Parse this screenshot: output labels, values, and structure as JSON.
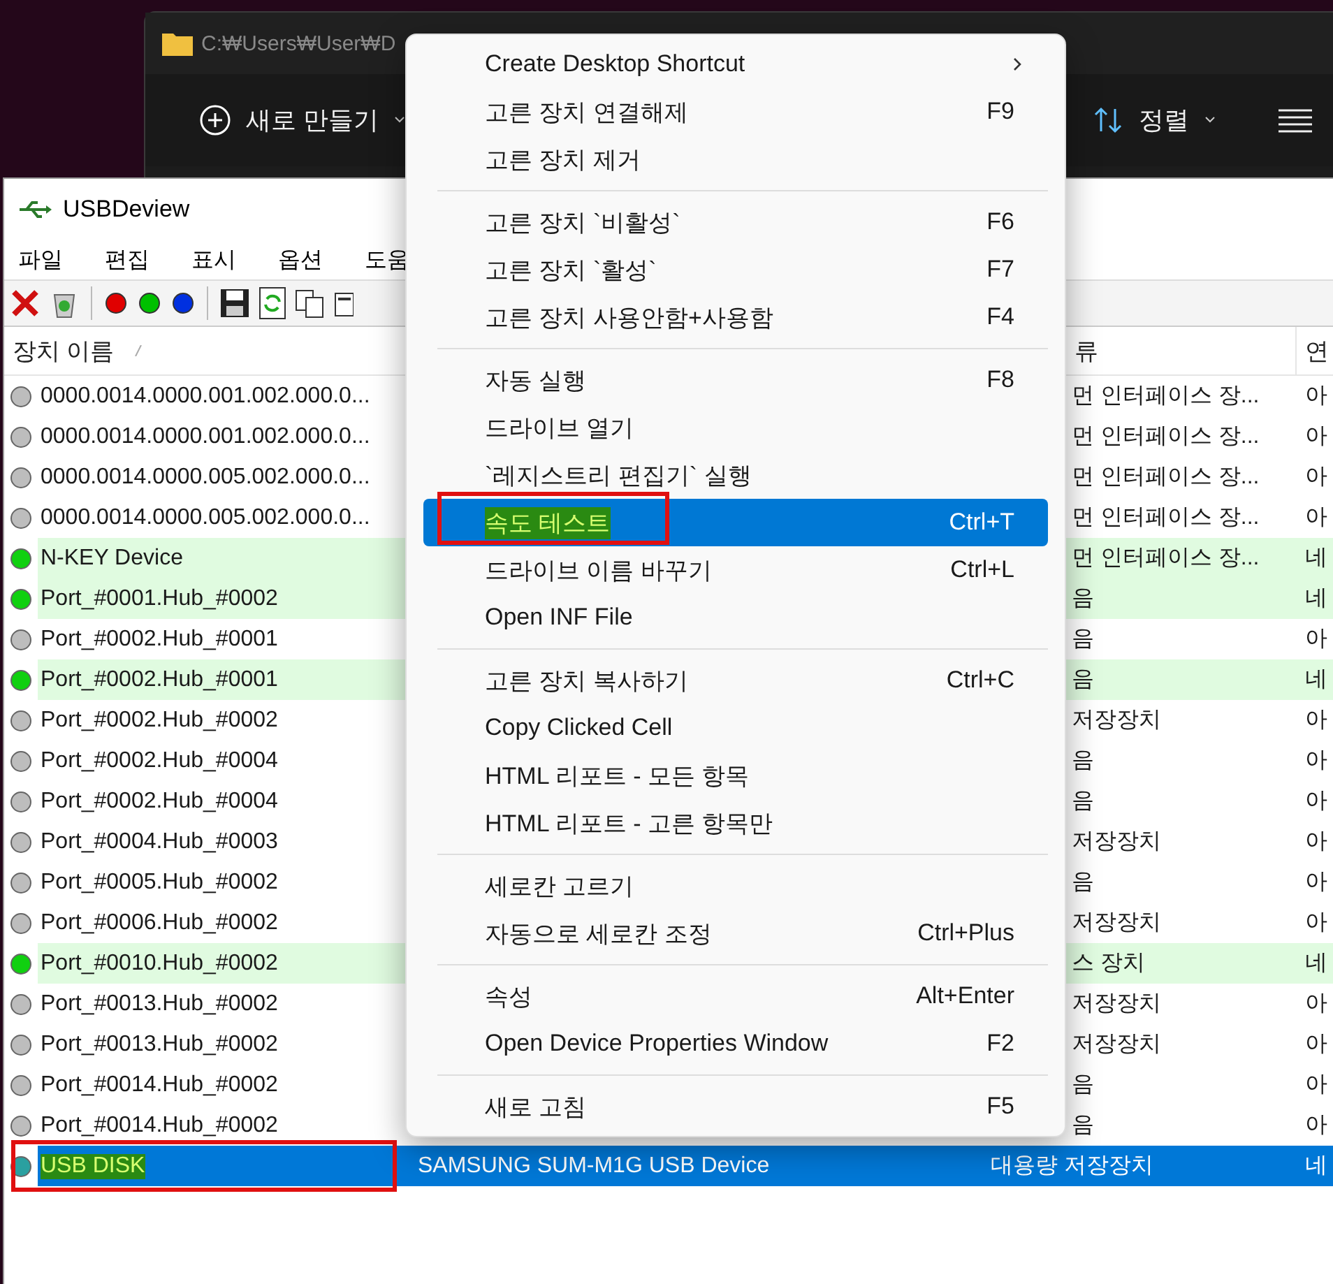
{
  "explorer": {
    "path": "C:₩Users₩User₩D",
    "toolbar": [
      {
        "kind": "new",
        "label": "새로 만들기"
      },
      {
        "kind": "sort",
        "label": "정렬"
      },
      {
        "kind": "view"
      }
    ]
  },
  "app": {
    "title": "USBDeview",
    "menu": [
      "파일",
      "편집",
      "표시",
      "옵션",
      "도움"
    ],
    "toolbar": [
      {
        "kind": "delete"
      },
      {
        "kind": "recycle"
      },
      {
        "kind": "dot",
        "color": "#e00000"
      },
      {
        "kind": "dot",
        "color": "#00c000"
      },
      {
        "kind": "dot",
        "color": "#0030e0"
      },
      {
        "kind": "save"
      },
      {
        "kind": "refresh"
      },
      {
        "kind": "copy"
      },
      {
        "kind": "properties"
      }
    ],
    "columns": [
      {
        "label": "장치 이름",
        "sorted": true
      },
      {
        "label": "류"
      },
      {
        "label": "연"
      }
    ],
    "rows": [
      {
        "name": "0000.0014.0000.001.002.000.0...",
        "connected": false,
        "selected": false,
        "type": "먼 인터페이스 장...",
        "column_4": "아"
      },
      {
        "name": "0000.0014.0000.001.002.000.0...",
        "connected": false,
        "selected": false,
        "type": "먼 인터페이스 장...",
        "column_4": "아"
      },
      {
        "name": "0000.0014.0000.005.002.000.0...",
        "connected": false,
        "selected": false,
        "type": "먼 인터페이스 장...",
        "column_4": "아"
      },
      {
        "name": "0000.0014.0000.005.002.000.0...",
        "connected": false,
        "selected": false,
        "type": "먼 인터페이스 장...",
        "column_4": "아"
      },
      {
        "name": "N-KEY Device",
        "connected": true,
        "selected": false,
        "type": "먼 인터페이스 장...",
        "column_4": "네"
      },
      {
        "name": "Port_#0001.Hub_#0002",
        "connected": true,
        "selected": false,
        "type": "음",
        "column_4": "네"
      },
      {
        "name": "Port_#0002.Hub_#0001",
        "connected": false,
        "selected": false,
        "type": "음",
        "column_4": "아"
      },
      {
        "name": "Port_#0002.Hub_#0001",
        "connected": true,
        "selected": false,
        "type": "음",
        "column_4": "네"
      },
      {
        "name": "Port_#0002.Hub_#0002",
        "connected": false,
        "selected": false,
        "type": "저장장치",
        "column_4": "아"
      },
      {
        "name": "Port_#0002.Hub_#0004",
        "connected": false,
        "selected": false,
        "type": "음",
        "column_4": "아"
      },
      {
        "name": "Port_#0002.Hub_#0004",
        "connected": false,
        "selected": false,
        "type": "음",
        "column_4": "아"
      },
      {
        "name": "Port_#0004.Hub_#0003",
        "connected": false,
        "selected": false,
        "type": "저장장치",
        "column_4": "아"
      },
      {
        "name": "Port_#0005.Hub_#0002",
        "connected": false,
        "selected": false,
        "type": "음",
        "column_4": "아"
      },
      {
        "name": "Port_#0006.Hub_#0002",
        "connected": false,
        "selected": false,
        "type": "저장장치",
        "column_4": "아"
      },
      {
        "name": "Port_#0010.Hub_#0002",
        "connected": true,
        "selected": false,
        "type": "스 장치",
        "column_4": "네"
      },
      {
        "name": "Port_#0013.Hub_#0002",
        "connected": false,
        "selected": false,
        "type": "저장장치",
        "column_4": "아"
      },
      {
        "name": "Port_#0013.Hub_#0002",
        "connected": false,
        "selected": false,
        "type": "저장장치",
        "column_4": "아"
      },
      {
        "name": "Port_#0014.Hub_#0002",
        "connected": false,
        "selected": false,
        "type": "음",
        "column_4": "아"
      },
      {
        "name": "Port_#0014.Hub_#0002",
        "connected": false,
        "selected": false,
        "type": "음",
        "column_4": "아"
      },
      {
        "name": "USB DISK",
        "connected": true,
        "selected": true,
        "marked": true,
        "column_2": "SAMSUNG SUM-M1G USB Device",
        "type": "대용량 저장장치",
        "column_4": "네"
      }
    ]
  },
  "context_menu": [
    {
      "kind": "item",
      "label": "Create Desktop Shortcut",
      "submenu": true,
      "selected": false
    },
    {
      "kind": "item",
      "label": "고른 장치 연결해제",
      "shortcut": "F9",
      "selected": false
    },
    {
      "kind": "item",
      "label": "고른 장치 제거",
      "selected": false
    },
    {
      "kind": "separator"
    },
    {
      "kind": "item",
      "label": "고른 장치 `비활성`",
      "shortcut": "F6",
      "selected": false
    },
    {
      "kind": "item",
      "label": "고른 장치 `활성`",
      "shortcut": "F7",
      "selected": false
    },
    {
      "kind": "item",
      "label": "고른 장치 사용안함+사용함",
      "shortcut": "F4",
      "selected": false
    },
    {
      "kind": "separator"
    },
    {
      "kind": "item",
      "label": "자동 실행",
      "shortcut": "F8",
      "selected": false
    },
    {
      "kind": "item",
      "label": "드라이브 열기",
      "selected": false
    },
    {
      "kind": "item",
      "label": "`레지스트리 편집기` 실행",
      "selected": false
    },
    {
      "kind": "item",
      "label": "속도 테스트",
      "shortcut": "Ctrl+T",
      "selected": true,
      "marked": true
    },
    {
      "kind": "item",
      "label": "드라이브 이름 바꾸기",
      "shortcut": "Ctrl+L",
      "selected": false
    },
    {
      "kind": "item",
      "label": "Open INF File",
      "selected": false
    },
    {
      "kind": "separator"
    },
    {
      "kind": "item",
      "label": "고른 장치 복사하기",
      "shortcut": "Ctrl+C",
      "selected": false
    },
    {
      "kind": "item",
      "label": "Copy Clicked Cell",
      "selected": false
    },
    {
      "kind": "item",
      "label": "HTML 리포트 - 모든 항목",
      "selected": false
    },
    {
      "kind": "item",
      "label": "HTML 리포트 - 고른 항목만",
      "selected": false
    },
    {
      "kind": "separator"
    },
    {
      "kind": "item",
      "label": "세로칸 고르기",
      "selected": false
    },
    {
      "kind": "item",
      "label": "자동으로 세로칸 조정",
      "shortcut": "Ctrl+Plus",
      "selected": false
    },
    {
      "kind": "separator"
    },
    {
      "kind": "item",
      "label": "속성",
      "shortcut": "Alt+Enter",
      "selected": false
    },
    {
      "kind": "item",
      "label": "Open Device Properties Window",
      "shortcut": "F2",
      "selected": false
    },
    {
      "kind": "separator"
    },
    {
      "kind": "item",
      "label": "새로 고침",
      "shortcut": "F5",
      "selected": false
    }
  ]
}
